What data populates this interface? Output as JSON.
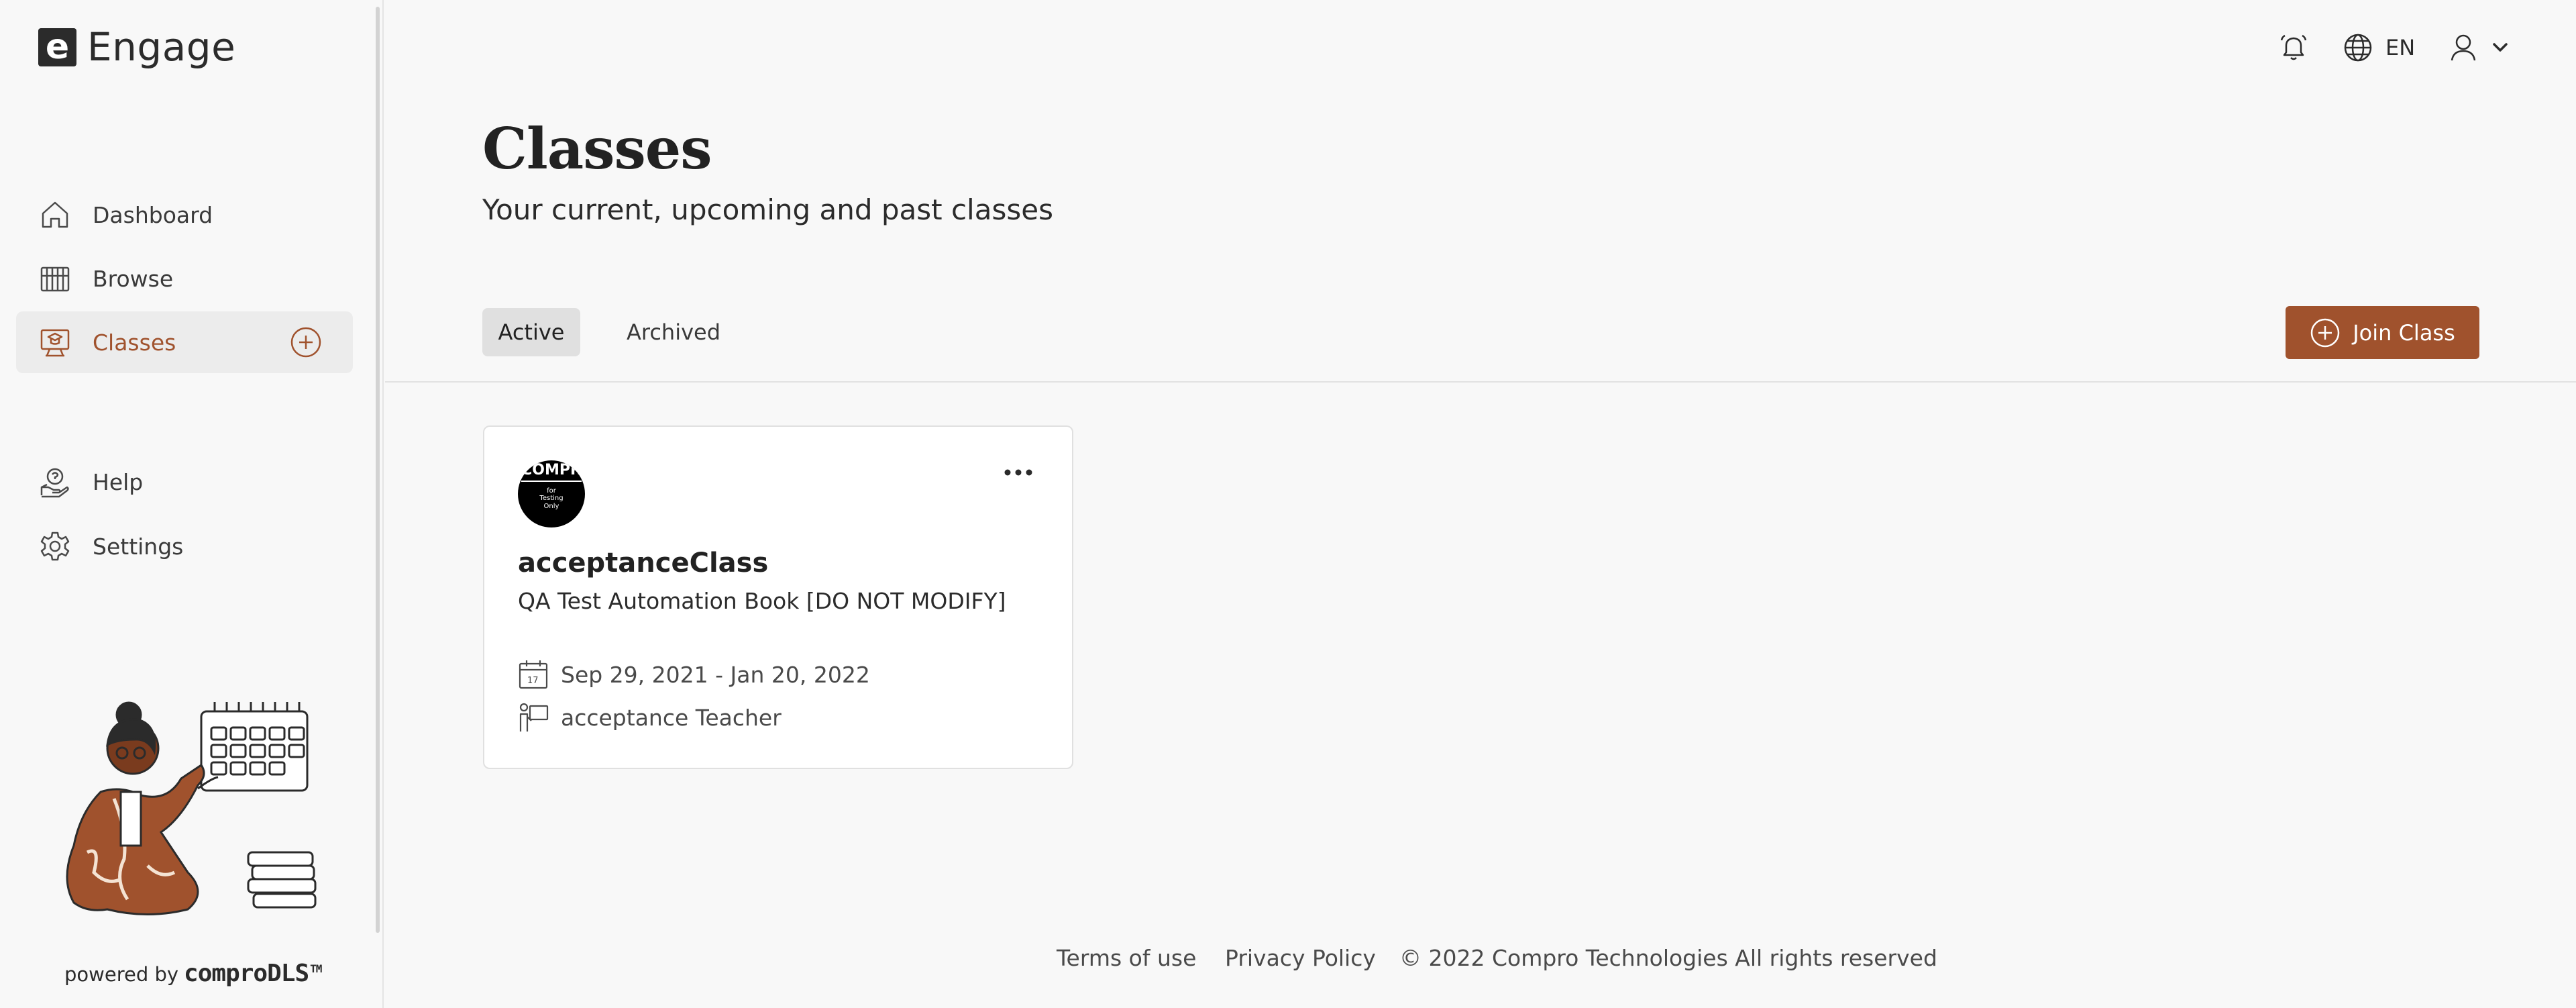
{
  "app": {
    "logo_letter": "e",
    "name": "Engage"
  },
  "sidebar": {
    "items": [
      {
        "label": "Dashboard",
        "icon": "home-icon"
      },
      {
        "label": "Browse",
        "icon": "library-icon"
      },
      {
        "label": "Classes",
        "icon": "classroom-icon",
        "active": true
      },
      {
        "label": "Help",
        "icon": "help-icon"
      },
      {
        "label": "Settings",
        "icon": "gear-icon"
      }
    ],
    "powered_by": {
      "label": "powered by",
      "brand": "comproDLS",
      "tm": "TM"
    }
  },
  "header": {
    "language": "EN",
    "icons": [
      "bell-icon",
      "globe-icon",
      "user-icon",
      "chevron-down-icon"
    ]
  },
  "main": {
    "title": "Classes",
    "subtitle": "Your current, upcoming and past classes",
    "tabs": [
      {
        "label": "Active",
        "selected": true
      },
      {
        "label": "Archived",
        "selected": false
      }
    ],
    "join_button": "Join Class",
    "classes": [
      {
        "avatar_text": "COMPR",
        "avatar_sub": "for\nTesting\nOnly",
        "name": "acceptanceClass",
        "book": "QA Test Automation Book [DO NOT MODIFY]",
        "dates": "Sep 29, 2021 - Jan 20, 2022",
        "teacher": "acceptance Teacher"
      }
    ]
  },
  "footer": {
    "terms": "Terms of use",
    "privacy": "Privacy Policy",
    "copyright": "© 2022 Compro Technologies All rights reserved"
  },
  "colors": {
    "accent": "#a0522d",
    "background": "#f8f8f8",
    "card": "#ffffff",
    "text": "#2b2b2b"
  }
}
